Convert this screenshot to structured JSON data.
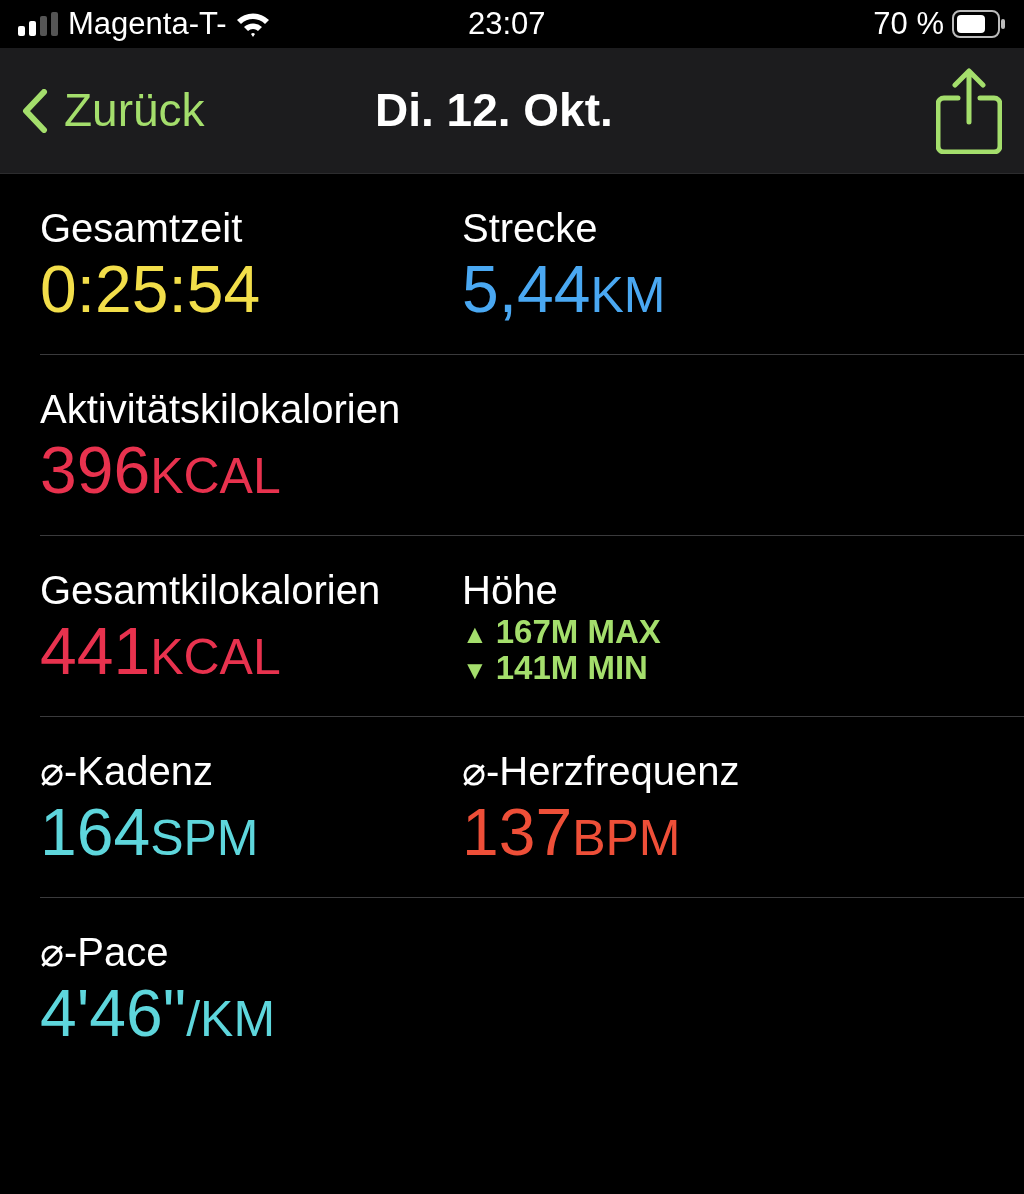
{
  "status_bar": {
    "carrier": "Magenta-T-",
    "time": "23:07",
    "battery": "70 %"
  },
  "nav": {
    "back": "Zurück",
    "title": "Di. 12. Okt."
  },
  "rows": [
    {
      "cells": [
        {
          "kind": "metric",
          "label": "Gesamtzeit",
          "value": "0:25:54",
          "color": "#f2de4a"
        },
        {
          "kind": "metric",
          "label": "Strecke",
          "value": "5,44",
          "unit": "KM",
          "color": "#4aa8f2"
        }
      ]
    },
    {
      "cells": [
        {
          "kind": "metric",
          "label": "Aktivitätskilokalorien",
          "value": "396",
          "unit": "KCAL",
          "color": "#e8324e"
        }
      ]
    },
    {
      "cells": [
        {
          "kind": "metric",
          "label": "Gesamtkilokalorien",
          "value": "441",
          "unit": "KCAL",
          "color": "#e8324e"
        },
        {
          "kind": "range",
          "label": "Höhe",
          "lines": [
            {
              "arrow": "▲",
              "text": "167M MAX"
            },
            {
              "arrow": "▼",
              "text": "141M MIN"
            }
          ],
          "color": "#a4de6c"
        }
      ]
    },
    {
      "cells": [
        {
          "kind": "metric",
          "label": "⌀-Kadenz",
          "value": "164",
          "unit": "SPM",
          "color": "#5ed6dc"
        },
        {
          "kind": "metric",
          "label": "⌀-Herzfrequenz",
          "value": "137",
          "unit": "BPM",
          "color": "#ee4f38"
        }
      ]
    },
    {
      "cells": [
        {
          "kind": "metric",
          "label": "⌀-Pace",
          "value": "4'46\"",
          "unit": "/KM",
          "color": "#5ed6dc"
        }
      ]
    }
  ]
}
